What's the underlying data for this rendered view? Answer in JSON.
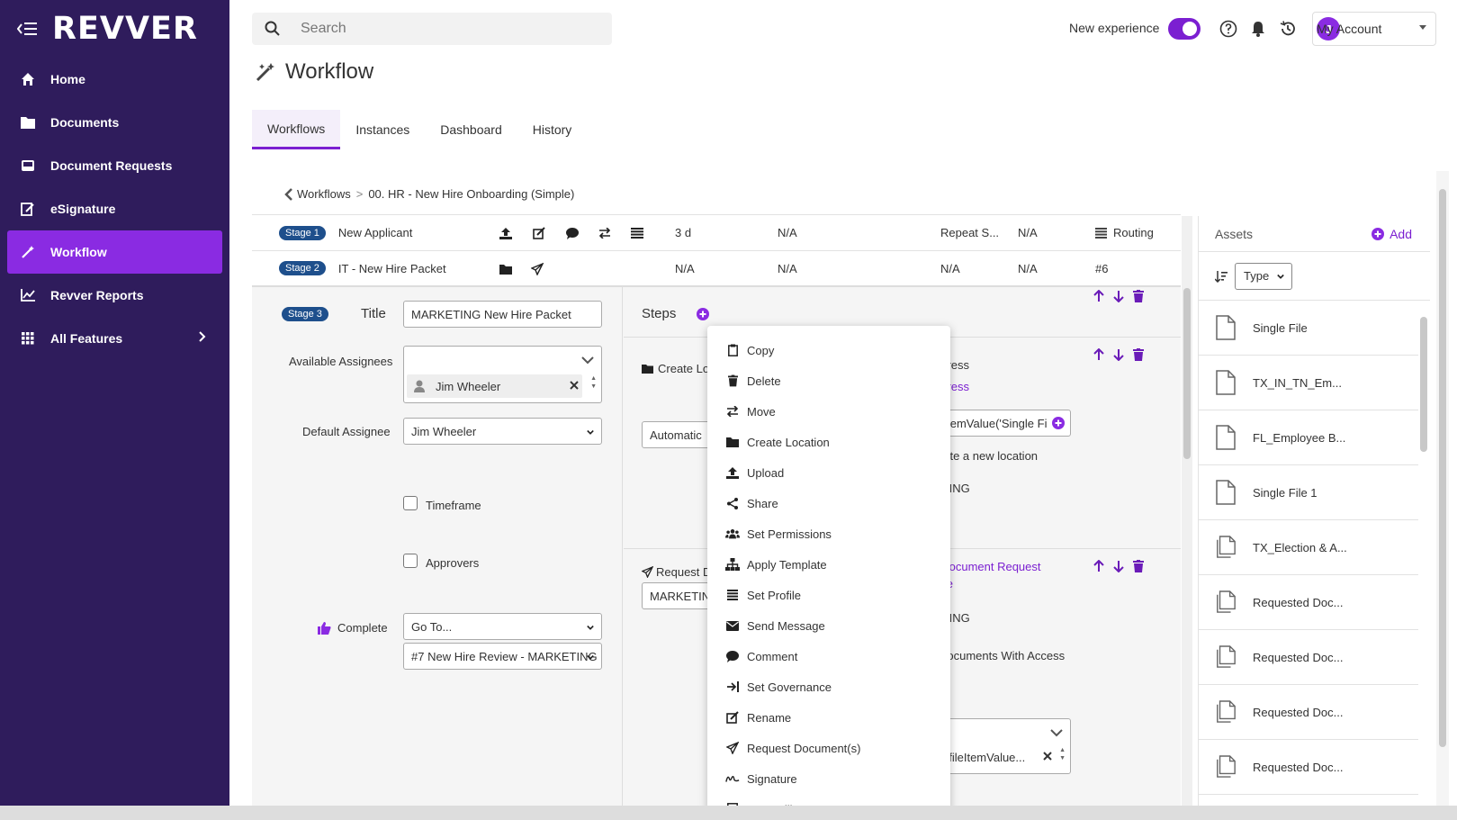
{
  "app": {
    "logo": "REVVER"
  },
  "sidebar": {
    "items": [
      {
        "label": "Home",
        "icon": "home-icon"
      },
      {
        "label": "Documents",
        "icon": "folder-icon"
      },
      {
        "label": "Document Requests",
        "icon": "inbox-icon"
      },
      {
        "label": "eSignature",
        "icon": "signature-icon"
      },
      {
        "label": "Workflow",
        "icon": "workflow-icon",
        "active": true
      },
      {
        "label": "Revver Reports",
        "icon": "chart-icon"
      },
      {
        "label": "All Features",
        "icon": "grid-icon"
      }
    ]
  },
  "topbar": {
    "search_placeholder": "Search",
    "new_experience_label": "New experience",
    "avatar_initial": "J",
    "account_label": "My Account"
  },
  "page": {
    "title": "Workflow",
    "tabs": [
      "Workflows",
      "Instances",
      "Dashboard",
      "History"
    ],
    "breadcrumb": {
      "root": "Workflows",
      "separator": ">",
      "current": "00. HR - New Hire Onboarding (Simple)"
    }
  },
  "stages": [
    {
      "badge": "Stage 1",
      "name": "New Applicant",
      "duration": "3 d",
      "col2": "N/A",
      "repeat": "Repeat S...",
      "col4": "N/A",
      "routing": "Routing"
    },
    {
      "badge": "Stage 2",
      "name": "IT - New Hire Packet",
      "duration": "N/A",
      "col2": "N/A",
      "repeat": "N/A",
      "col4": "N/A",
      "routing": "#6"
    }
  ],
  "stage3": {
    "badge": "Stage 3",
    "title_label": "Title",
    "title_value": "MARKETING New Hire Packet",
    "available_assignees_label": "Available Assignees",
    "assignee_chip": "Jim Wheeler",
    "default_assignee_label": "Default Assignee",
    "default_assignee_value": "Jim Wheeler",
    "timeframe_label": "Timeframe",
    "approvers_label": "Approvers",
    "complete_label": "Complete",
    "goto_value": "Go To...",
    "goto_target": "#7 New Hire Review - MARKETING"
  },
  "steps": {
    "label": "Steps",
    "step1_label": "Create Lo",
    "step1_right_1": "ogress",
    "step1_right_2": "ogress",
    "step1_input": "Automatic",
    "step1_formula": "eltemValue('Single Fi",
    "step1_note": "eate a new location",
    "step1_tail": "ETING",
    "step2_label": "Request D",
    "step2_link_1": "t Document Request",
    "step2_link_2": "late",
    "step2_input": "MARKETING",
    "step2_tail": "ETING",
    "step2_note": "Documents With Access",
    "step2_formula": "ProfileItemValue..."
  },
  "context_menu": [
    {
      "label": "Copy",
      "icon": "clipboard-icon"
    },
    {
      "label": "Delete",
      "icon": "trash-icon"
    },
    {
      "label": "Move",
      "icon": "move-icon"
    },
    {
      "label": "Create Location",
      "icon": "folder-icon"
    },
    {
      "label": "Upload",
      "icon": "upload-icon"
    },
    {
      "label": "Share",
      "icon": "share-icon"
    },
    {
      "label": "Set Permissions",
      "icon": "users-icon"
    },
    {
      "label": "Apply Template",
      "icon": "sitemap-icon"
    },
    {
      "label": "Set Profile",
      "icon": "list-icon"
    },
    {
      "label": "Send Message",
      "icon": "envelope-icon"
    },
    {
      "label": "Comment",
      "icon": "comment-icon"
    },
    {
      "label": "Set Governance",
      "icon": "arrow-to-bar-icon"
    },
    {
      "label": "Rename",
      "icon": "edit-icon"
    },
    {
      "label": "Request Document(s)",
      "icon": "paper-plane-icon"
    },
    {
      "label": "Signature",
      "icon": "signature-icon"
    },
    {
      "label": "Form Fill",
      "icon": "form-icon"
    }
  ],
  "assets": {
    "header": "Assets",
    "add_label": "Add",
    "type_select": "Type",
    "items": [
      {
        "name": "Single File",
        "icon": "file-icon"
      },
      {
        "name": "TX_IN_TN_Em...",
        "icon": "file-icon"
      },
      {
        "name": "FL_Employee B...",
        "icon": "file-icon"
      },
      {
        "name": "Single File 1",
        "icon": "file-icon"
      },
      {
        "name": "TX_Election & A...",
        "icon": "files-icon"
      },
      {
        "name": "Requested Doc...",
        "icon": "files-icon"
      },
      {
        "name": "Requested Doc...",
        "icon": "files-icon"
      },
      {
        "name": "Requested Doc...",
        "icon": "files-icon"
      },
      {
        "name": "Requested Doc...",
        "icon": "files-icon"
      }
    ]
  },
  "colors": {
    "sidebar": "#2f1c5c",
    "accent": "#8a2be2",
    "stage_badge": "#1e4f8c"
  }
}
